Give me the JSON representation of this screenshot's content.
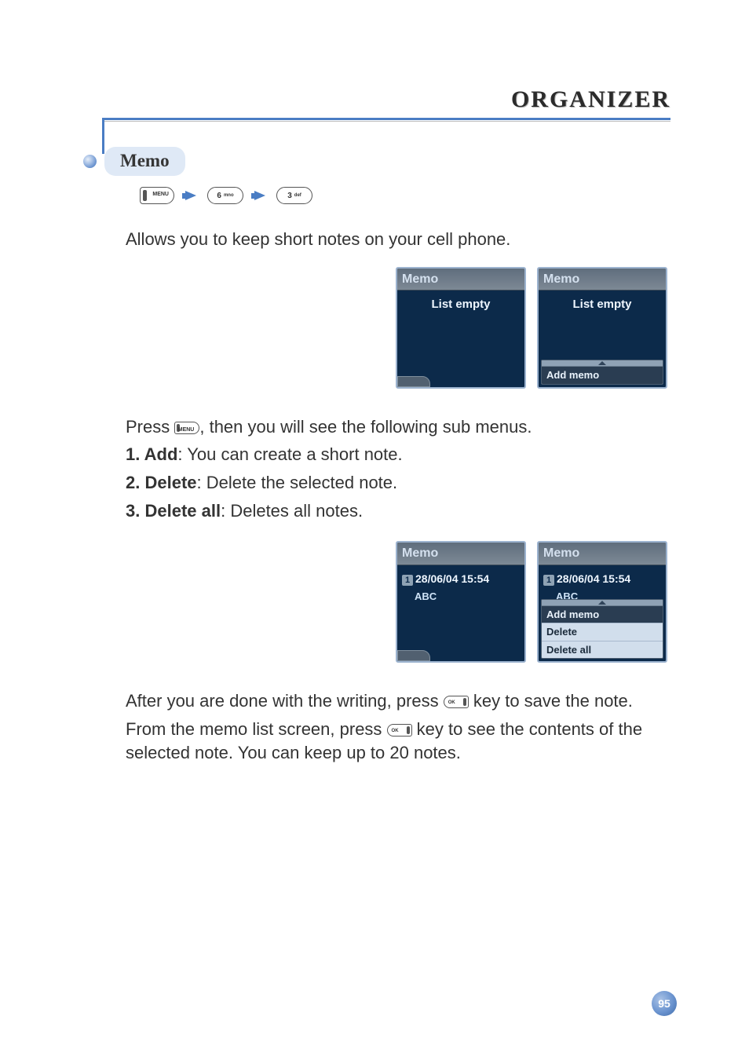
{
  "chapterTitle": "ORGANIZER",
  "section": {
    "title": "Memo",
    "nav_keys": [
      "MENU",
      "6 mno",
      "3 def"
    ]
  },
  "intro": "Allows you to keep short notes on your cell phone.",
  "screens1": [
    {
      "title": "Memo",
      "empty": "List empty",
      "popup": null
    },
    {
      "title": "Memo",
      "empty": "List empty",
      "popup": [
        "Add memo"
      ]
    }
  ],
  "submenu_lead": "Press       , then you will see the following sub menus.",
  "inline_key_1": "MENU",
  "items": [
    {
      "num": "1.",
      "name": "Add",
      "desc": ": You can create a short note."
    },
    {
      "num": "2.",
      "name": "Delete",
      "desc": ": Delete the selected note."
    },
    {
      "num": "3.",
      "name": "Delete all",
      "desc": ": Deletes all notes."
    }
  ],
  "screens2": [
    {
      "title": "Memo",
      "entry_idx": "1",
      "entry": "28/06/04 15:54",
      "sub": "ABC",
      "popup": null
    },
    {
      "title": "Memo",
      "entry_idx": "1",
      "entry": "28/06/04 15:54",
      "sub": "ABC",
      "popup": [
        "Add memo",
        "Delete",
        "Delete all"
      ]
    }
  ],
  "after_para1_a": "After you are done with the writing, press ",
  "after_para1_b": " key to save the note.",
  "after_para2_a": "From the memo list screen, press ",
  "after_para2_b": " key to see the contents of the selected note. You can keep up to 20 notes.",
  "inline_key_ok": "OK",
  "pageNumber": "95"
}
